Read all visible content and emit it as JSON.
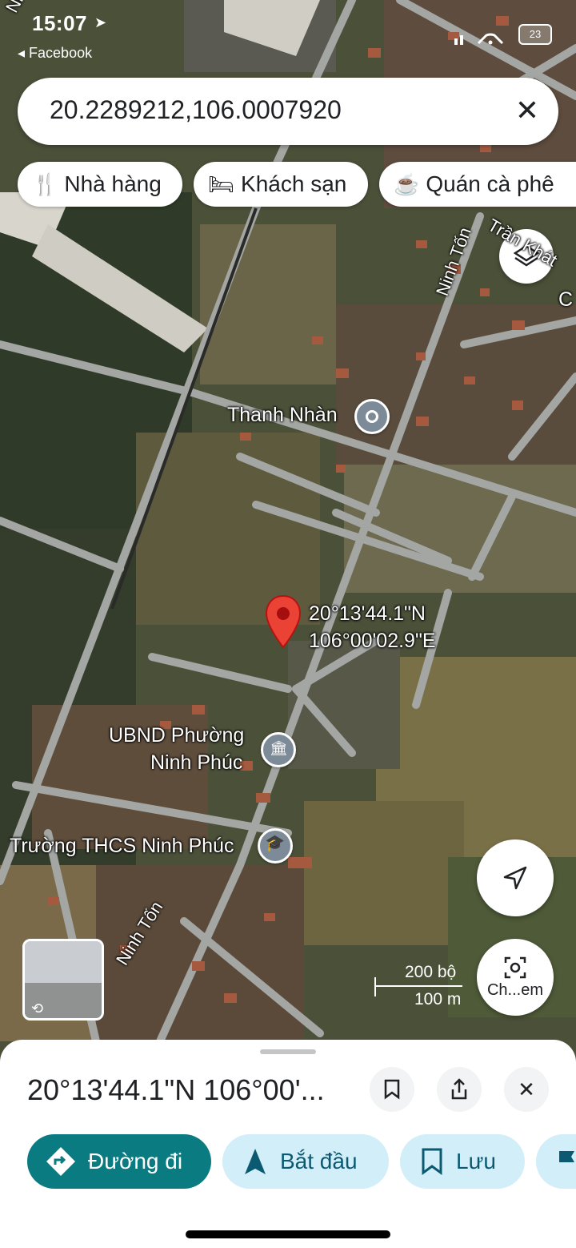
{
  "status_bar": {
    "time": "15:07",
    "back_app": "◂ Facebook",
    "battery": "23"
  },
  "search": {
    "query": "20.2289212,106.0007920"
  },
  "chips": [
    {
      "icon": "restaurant-icon",
      "label": "Nhà hàng"
    },
    {
      "icon": "hotel-icon",
      "label": "Khách sạn"
    },
    {
      "icon": "coffee-icon",
      "label": "Quán cà phê"
    }
  ],
  "map": {
    "labels": {
      "road_top_left": "Nhân",
      "road_ninh_ton_top": "Ninh Tốn",
      "road_tran_khat": "Trần Khát",
      "letter_c": "C",
      "poi_thanh_nhan": "Thanh Nhàn",
      "poi_ubnd_line1": "UBND Phường",
      "poi_ubnd_line2": "Ninh Phúc",
      "poi_school": "Trường THCS Ninh Phúc",
      "road_ninh_ton_bottom": "Ninh Tốn"
    },
    "pin_label_line1": "20°13'44.1\"N",
    "pin_label_line2": "106°00'02.9\"E",
    "scale_feet": "200 bộ",
    "scale_meters": "100 m"
  },
  "fabs": {
    "search_image_label": "Ch...em"
  },
  "sheet": {
    "title": "20°13'44.1\"N 106°00'...",
    "actions": [
      {
        "label": "Đường đi"
      },
      {
        "label": "Bắt đầu"
      },
      {
        "label": "Lưu"
      }
    ]
  },
  "colors": {
    "primary": "#0b7b82",
    "chip_bg": "#d2eef8",
    "pin_red": "#ea4335"
  }
}
